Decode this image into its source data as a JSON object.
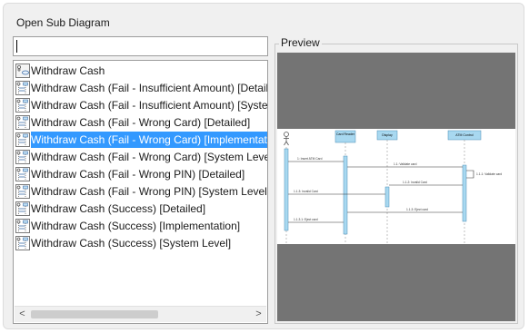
{
  "dialog": {
    "title": "Open Sub Diagram"
  },
  "search": {
    "value": "",
    "placeholder": ""
  },
  "list": {
    "items": [
      {
        "label": "Withdraw Cash",
        "icon": "use-case-diagram-icon"
      },
      {
        "label": "Withdraw Cash (Fail - Insufficient Amount) [Detailed]",
        "icon": "sequence-diagram-icon"
      },
      {
        "label": "Withdraw Cash (Fail - Insufficient Amount) [System Level]",
        "icon": "sequence-diagram-icon"
      },
      {
        "label": "Withdraw Cash (Fail - Wrong Card) [Detailed]",
        "icon": "sequence-diagram-icon"
      },
      {
        "label": "Withdraw Cash (Fail - Wrong Card) [Implementation]",
        "icon": "sequence-diagram-icon"
      },
      {
        "label": "Withdraw Cash (Fail - Wrong Card) [System Level]",
        "icon": "sequence-diagram-icon"
      },
      {
        "label": "Withdraw Cash (Fail - Wrong PIN) [Detailed]",
        "icon": "sequence-diagram-icon"
      },
      {
        "label": "Withdraw Cash (Fail - Wrong PIN) [System Level]",
        "icon": "sequence-diagram-icon"
      },
      {
        "label": "Withdraw Cash (Success) [Detailed]",
        "icon": "sequence-diagram-icon"
      },
      {
        "label": "Withdraw Cash (Success) [Implementation]",
        "icon": "sequence-diagram-icon"
      },
      {
        "label": "Withdraw Cash (Success) [System Level]",
        "icon": "sequence-diagram-icon"
      }
    ],
    "selected_index": 4,
    "scroll_left_glyph": "<",
    "scroll_right_glyph": ">"
  },
  "preview": {
    "legend": "Preview",
    "lifelines": [
      "Card Reader",
      "Display",
      "ATM Control"
    ],
    "messages": [
      "1: Insert ATM Card",
      "1.1: Validate card",
      "1.1.1: Validate card",
      "1.1.2: Invalid Card",
      "1.1.3: Invalid Card",
      "1.1.3: Eject card",
      "1.1.3.1: Eject card"
    ]
  },
  "colors": {
    "selection": "#3399ff",
    "preview_bg": "#747474",
    "lifeline_box": "#a8d8f0"
  }
}
